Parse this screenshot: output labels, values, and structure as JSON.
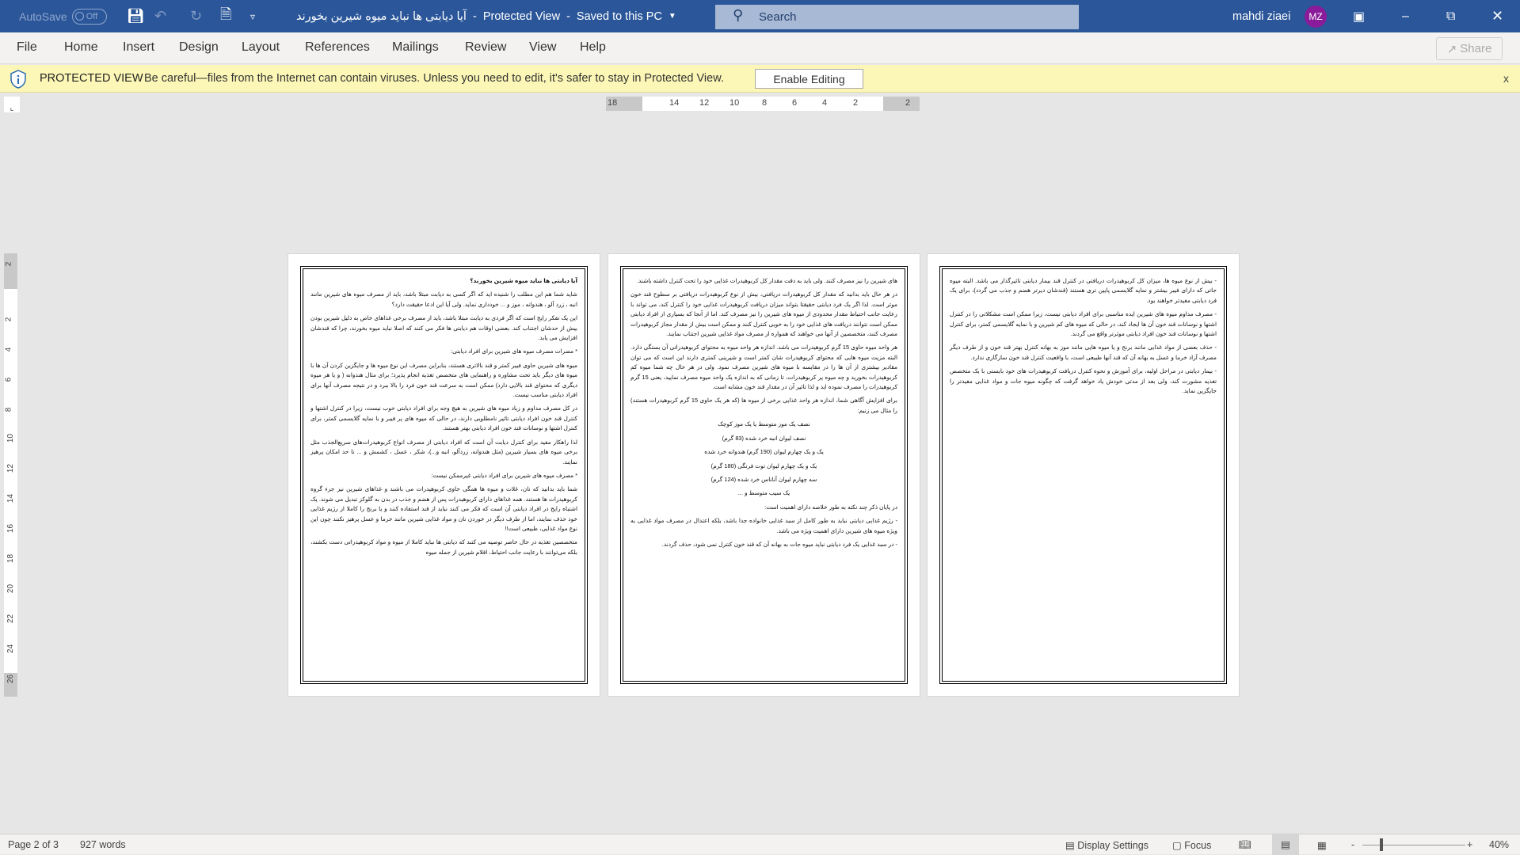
{
  "titlebar": {
    "autosave": "AutoSave",
    "autosave_state": "Off",
    "doc_title": "آیا دیابتی ها نباید میوه شیرین بخورند",
    "mode": "Protected View",
    "saved": "Saved to this PC",
    "search_placeholder": "Search",
    "user": "mahdi ziaei",
    "initials": "MZ",
    "accent": "#2b579a",
    "avatar_color": "#8a1b9a"
  },
  "ribbon": {
    "tabs": [
      "File",
      "Home",
      "Insert",
      "Design",
      "Layout",
      "References",
      "Mailings",
      "Review",
      "View",
      "Help"
    ],
    "share": "Share"
  },
  "protected": {
    "label": "PROTECTED VIEW",
    "message": "Be careful—files from the Internet can contain viruses. Unless you need to edit, it's safer to stay in Protected View.",
    "button": "Enable Editing",
    "close": "x"
  },
  "ruler": {
    "h": [
      "18",
      "14",
      "12",
      "10",
      "8",
      "6",
      "4",
      "2",
      "2"
    ],
    "v": [
      "2",
      "2",
      "4",
      "6",
      "8",
      "10",
      "12",
      "14",
      "16",
      "18",
      "20",
      "22",
      "24",
      "26"
    ]
  },
  "pages": [
    {
      "paragraphs": [
        {
          "t": "آیا دیابتی ها نباید میوه شیرین بخورند؟",
          "s": "h"
        },
        {
          "t": "شاید شما هم این مطلب را شنیده اید که اگر کسی به دیابت مبتلا باشد، باید از مصرف میوه های شیرین مانند انبه ، زرد آلو ، هندوانه ، موز و ... خودداری نماید. ولی آیا این ادعا حقیقت دارد؟"
        },
        {
          "t": "این یک تفکر رایج است که اگر فردی به دیابت مبتلا باشد، باید از مصرف برخی غذاهای خاص به دلیل شیرین بودن بیش از حدشان اجتناب کند. بعضی اوقات هم دیابتی ها فکر می کنند که اصلا نباید میوه بخورند، چرا که قندشان افزایش می یابد."
        },
        {
          "t": "* مضرات مصرف میوه های شیرین برای افراد دیابتی:"
        },
        {
          "t": "میوه های شیرین حاوی فیبر کمتر و قند بالاتری هستند، بنابراین مصرف این نوع میوه ها و جایگزین کردن آن ها با میوه های دیگر باید تحت مشاوره و راهنمایی های متخصص تغذیه انجام پذیرد؛ برای مثال هندوانه ( و یا هر میوه دیگری که محتوای قند بالایی دارد) ممکن است به سرعت قند خون فرد را بالا ببرد و در نتیجه مصرف آنها برای افراد دیابتی مناسب نیست."
        },
        {
          "t": "در کل مصرف مداوم و زیاد میوه های شیرین به هیچ وجه برای افراد دیابتی خوب نیست، زیرا در کنترل اشتها و کنترل قند خون افراد دیابتی تاثیر نامطلوبی دارند، در حالی که میوه های پر فیبر و با نمایه گلایسمی کمتر، برای کنترل اشتها و نوسانات قند خون افراد دیابتی بهتر هستند."
        },
        {
          "t": "لذا راهکار مفید برای کنترل دیابت آن است که افراد دیابتی از مصرف انواع کربوهیدرات‌های سریع‌الجذب مثل برخی میوه های بسیار شیرین (مثل هندوانه، زردآلو، انبه و...)، شکر ، عسل ، کشمش و ... تا حد امکان پرهیز نمایند."
        },
        {
          "t": "* مصرف میوه های شیرین برای افراد دیابتی غیرممکن نیست:"
        },
        {
          "t": "شما باید بدانید که نان، غلات و میوه ها همگی حاوی کربوهیدرات می باشند و غذاهای شیرین نیز جزء گروه کربوهیدرات ها هستند. همه غذاهای دارای کربوهیدرات پس از هضم و جذب در بدن به گلوکز تبدیل می شوند. یک اشتباه رایج در افراد دیابتی آن است که فکر می کنند نباید از قند استفاده کنند و یا برنج را کاملا از رژیم غذایی خود حذف نمایند، اما از طرف دیگر در خوردن نان و مواد غذایی شیرین مانند خرما و عسل پرهیز نکنند چون این نوع مواد غذایی، طبیعی است!!"
        },
        {
          "t": "متخصصین تغذیه در حال حاضر توصیه می کنند که دیابتی ها نباید کاملا از میوه و مواد کربوهیدراتی دست بکشند، بلکه می‌توانند با رعایت جانب احتیاط، اقلام شیرین از جمله میوه"
        }
      ]
    },
    {
      "paragraphs": [
        {
          "t": "های شیرین را نیز مصرف کنند. ولی باید به دقت مقدار کل کربوهیدرات غذایی خود را تحت کنترل داشته باشند."
        },
        {
          "t": "در هر حال باید بدانید که مقدار کل کربوهیدرات دریافتی، بیش از نوع کربوهیدرات دریافتی بر سطوح قند خون موثر است. لذا اگر یک فرد دیابتی حقیقتا بتواند میزان دریافت کربوهیدرات غذایی خود را کنترل کند، می تواند با رعایت جانب احتیاط مقدار محدودی از میوه های شیرین را نیز مصرف کند. اما از آنجا که بسیاری از افراد دیابتی ممکن است نتوانند دریافت های غذایی خود را به خوبی کنترل کنند و ممکن است بیش از مقدار مجاز کربوهیدرات مصرف کنند، متخصصین از آنها می خواهند که همواره از مصرف مواد غذایی شیرین اجتناب نمایند."
        },
        {
          "t": "هر واحد میوه حاوی 15 گرم کربوهیدرات می باشد. اندازه هر واحد میوه به محتوای کربوهیدراتی آن بستگی دارد. البته مزیت میوه هایی که محتوای کربوهیدرات شان کمتر است و شیرینی کمتری دارند این است که می توان مقادیر بیشتری از آن ها را در مقایسه با میوه های شیرین مصرف نمود. ولی در هر حال چه شما میوه کم کربوهیدرات بخورید و چه میوه پر کربوهیدرات، تا زمانی که به اندازه یک واحد میوه مصرف نمایید، یعنی 15 گرم کربوهیدرات را مصرف نموده اید و لذا تاثیر آن در مقدار قند خون مشابه است."
        },
        {
          "t": "برای افزایش آگاهی شما، اندازه هر واحد غذایی برخی از میوه ها (که هر یک حاوی 15 گرم کربوهیدرات هستند) را مثال می زنیم:"
        },
        {
          "t": "نصف یک موز متوسط یا یک موز کوچک",
          "s": "c"
        },
        {
          "t": "نصف لیوان انبه خرد شده (83 گرم)",
          "s": "c"
        },
        {
          "t": "یک و یک چهارم لیوان (190 گرم) هندوانه خرد شده",
          "s": "c"
        },
        {
          "t": "یک و یک چهارم لیوان توت فرنگی (180 گرم)",
          "s": "c"
        },
        {
          "t": "سه چهارم لیوان آناناس خرد شده (124 گرم)",
          "s": "c"
        },
        {
          "t": "یک سیب متوسط و ...",
          "s": "c"
        },
        {
          "t": "در پایان ذکر چند نکته به طور خلاصه دارای اهمیت است:"
        },
        {
          "t": "- رژیم غذایی دیابتی نباید به طور کامل از سبد غذایی خانواده جدا باشد، بلکه اعتدال در مصرف مواد غذایی به ویژه میوه های شیرین دارای اهمیت ویژه می باشد."
        },
        {
          "t": "- در سبد غذایی یک فرد دیابتی نباید میوه جات به بهانه آن که قند خون کنترل نمی شود، حذف گردند."
        }
      ]
    },
    {
      "paragraphs": [
        {
          "t": "- بیش از نوع میوه ها، میزان کل کربوهیدرات دریافتی در کنترل قند بیمار دیابتی تاثیرگذار می باشد. البته میوه جاتی که دارای فیبر بیشتر و نمایه گلایسمی پایین تری هستند (قندشان دیرتر هضم و جذب می گردد)، برای یک فرد دیابتی مفیدتر خواهند بود."
        },
        {
          "t": "- مصرف مداوم میوه های شیرین ایده مناسبی برای افراد دیابتی نیست، زیرا ممکن است مشکلاتی را در کنترل اشتها و نوسانات قند خون آن ها ایجاد کند، در حالی که میوه های کم شیرین و با نمایه گلایسمی کمتر، برای کنترل اشتها و نوسانات قند خون افراد دیابتی موثرتر واقع می گردند."
        },
        {
          "t": "- حذف بعضی از مواد غذایی مانند برنج و یا میوه هایی مانند موز به بهانه کنترل بهتر قند خون و از طرف دیگر مصرف آزاد خرما و عسل به بهانه آن که قند آنها طبیعی است، با واقعیت کنترل قند خون سازگاری ندارد."
        },
        {
          "t": "- بیمار دیابتی در مراحل اولیه، برای آموزش و نحوه کنترل دریافت کربوهیدرات های خود بایستی با یک متخصص تغذیه مشورت کند، ولی بعد از مدتی خودش یاد خواهد گرفت که چگونه میوه جات و مواد غذایی مفیدتر را جایگزین نماید."
        }
      ]
    }
  ],
  "status": {
    "page": "Page 2 of 3",
    "words": "927 words",
    "display_settings": "Display Settings",
    "focus": "Focus",
    "zoom": "40%",
    "zoom_minus": "-",
    "zoom_plus": "+"
  }
}
